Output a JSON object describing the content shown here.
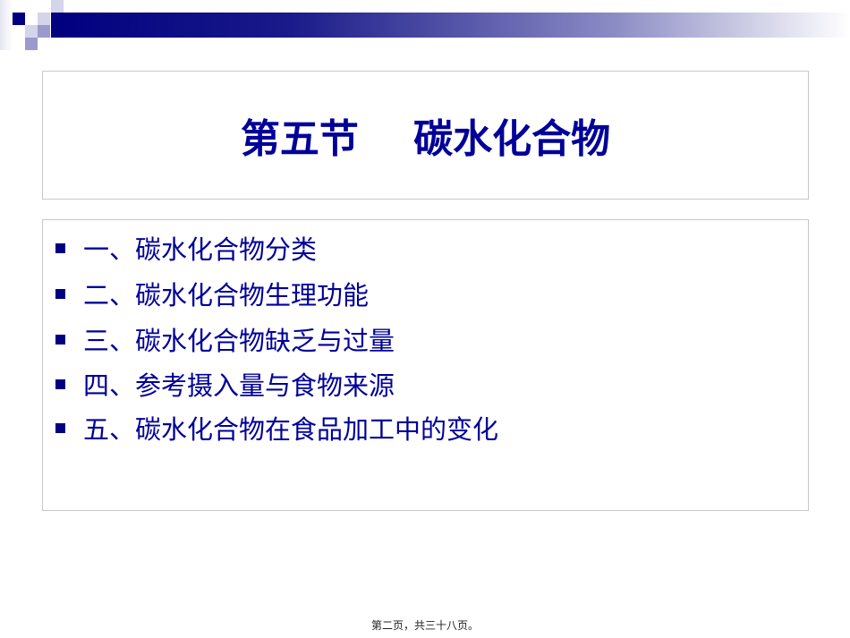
{
  "slide": {
    "title": "第五节    碳水化合物",
    "items": [
      "一、碳水化合物分类",
      "二、碳水化合物生理功能",
      "三、碳水化合物缺乏与过量",
      "四、参考摄入量与食物来源",
      "五、碳水化合物在食品加工中的变化"
    ],
    "footer": "第二页，共三十八页。"
  },
  "colors": {
    "text": "#000099",
    "accent": "#000080"
  }
}
